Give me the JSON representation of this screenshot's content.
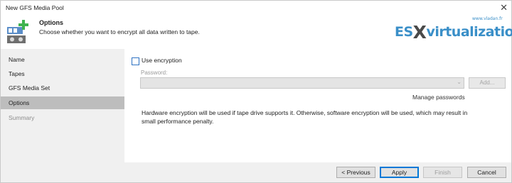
{
  "window": {
    "title": "New GFS Media Pool",
    "close_glyph": "✕"
  },
  "header": {
    "title": "Options",
    "subtitle": "Choose whether you want to encrypt all data written to tape.",
    "icon": "tape-media-pool-add-icon"
  },
  "watermark": {
    "small": "www.vladan.fr",
    "big_left": "ES",
    "big_x": "X",
    "big_right": "virtualization"
  },
  "sidebar": {
    "items": [
      {
        "label": "Name",
        "state": "normal"
      },
      {
        "label": "Tapes",
        "state": "normal"
      },
      {
        "label": "GFS Media Set",
        "state": "normal"
      },
      {
        "label": "Options",
        "state": "active"
      },
      {
        "label": "Summary",
        "state": "disabled"
      }
    ]
  },
  "options": {
    "use_encryption_label": "Use encryption",
    "use_encryption_checked": false,
    "password_label": "Password:",
    "password_value": "",
    "add_label": "Add...",
    "manage_passwords_label": "Manage passwords",
    "info_text": "Hardware encryption will be used if tape drive supports it. Otherwise, software encryption will be used, which may result in small performance penalty."
  },
  "footer": {
    "previous_label": "< Previous",
    "apply_label": "Apply",
    "finish_label": "Finish",
    "cancel_label": "Cancel"
  },
  "colors": {
    "accent": "#0078d7",
    "active_nav": "#bdbdbd",
    "watermark": "#3a8fc8"
  }
}
